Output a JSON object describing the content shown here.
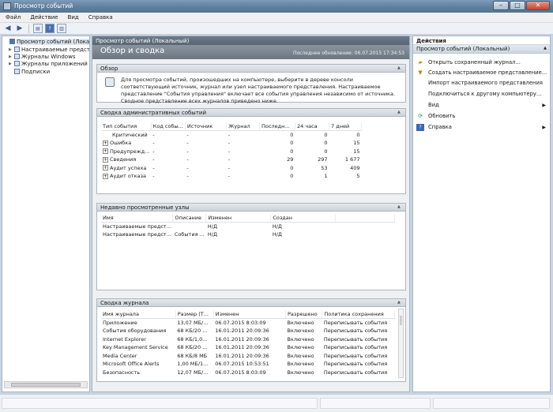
{
  "window": {
    "title": "Просмотр событий"
  },
  "menu": [
    "Файл",
    "Действие",
    "Вид",
    "Справка"
  ],
  "toolbar": {
    "buttons": [
      "back-icon",
      "forward-icon",
      "console-tree-icon",
      "help-icon",
      "action-pane-icon"
    ]
  },
  "tree": {
    "root": "Просмотр событий (Локальный)",
    "items": [
      "Настраиваемые представле",
      "Журналы Windows",
      "Журналы приложений и сл",
      "Подписки"
    ]
  },
  "center": {
    "header": "Просмотр событий (Локальный)",
    "banner_title": "Обзор и сводка",
    "last_update": "Последнее обновление: 06.07.2015 17:34:53",
    "overview": {
      "title": "Обзор",
      "text": "Для просмотра событий, произошедших на компьютере, выберите в дереве консоли соответствующий источник, журнал или узел настраиваемого представления. Настраиваемое представление \"События управления\" включает все события управления независимо от источника. Сводное представление всех журналов приведено ниже."
    },
    "admin_summary": {
      "title": "Сводка административных событий",
      "columns": [
        "Тип события",
        "Код собы...",
        "Источник",
        "Журнал",
        "Последн...",
        "24 часа",
        "7 дней"
      ],
      "rows": [
        [
          "Критический",
          "-",
          "-",
          "-",
          "0",
          "0",
          "0"
        ],
        [
          "Ошибка",
          "-",
          "-",
          "-",
          "0",
          "0",
          "15"
        ],
        [
          "Предупрежд...",
          "-",
          "-",
          "-",
          "0",
          "0",
          "15"
        ],
        [
          "Сведения",
          "-",
          "-",
          "-",
          "29",
          "297",
          "1 677"
        ],
        [
          "Аудит успеха",
          "-",
          "-",
          "-",
          "0",
          "53",
          "409"
        ],
        [
          "Аудит отказа",
          "-",
          "-",
          "-",
          "0",
          "1",
          "5"
        ]
      ]
    },
    "recent_nodes": {
      "title": "Недавно просмотренные узлы",
      "columns": [
        "Имя",
        "Описание",
        "Изменен",
        "Создан"
      ],
      "rows": [
        [
          "Настраиваемые предст...",
          "",
          "Н/Д",
          "Н/Д"
        ],
        [
          "Настраиваемые предст...",
          "События ...",
          "Н/Д",
          "Н/Д"
        ]
      ]
    },
    "log_summary": {
      "title": "Сводка журнала",
      "columns": [
        "Имя журнала",
        "Размер (Т...",
        "Изменен",
        "Разрешено",
        "Политика сохранения"
      ],
      "rows": [
        [
          "Приложение",
          "13,07 МБ/...",
          "06.07.2015 8:03:09",
          "Включено",
          "Переписывать события"
        ],
        [
          "События оборудования",
          "68 КБ/20 ...",
          "16.01.2011 20:09:36",
          "Включено",
          "Переписывать события"
        ],
        [
          "Internet Explorer",
          "68 КБ/1,0...",
          "16.01.2011 20:09:36",
          "Включено",
          "Переписывать события"
        ],
        [
          "Key Management Service",
          "68 КБ/20 ...",
          "16.01.2011 20:09:36",
          "Включено",
          "Переписывать события"
        ],
        [
          "Media Center",
          "68 КБ/8 МБ",
          "16.01.2011 20:09:36",
          "Включено",
          "Переписывать события"
        ],
        [
          "Microsoft Office Alerts",
          "1,00 МБ/1...",
          "06.07.2015 10:53:51",
          "Включено",
          "Переписывать события"
        ],
        [
          "Безопасность",
          "12,07 МБ/...",
          "06.07.2015 8:03:09",
          "Включено",
          "Переписывать события"
        ]
      ]
    }
  },
  "actions": {
    "title": "Действия",
    "subtitle": "Просмотр событий (Локальный)",
    "items": [
      "Открыть сохраненный журнал...",
      "Создать настраиваемое представление...",
      "Импорт настраиваемого представления",
      "Подключиться к другому компьютеру...",
      "Вид",
      "Обновить",
      "Справка"
    ]
  }
}
